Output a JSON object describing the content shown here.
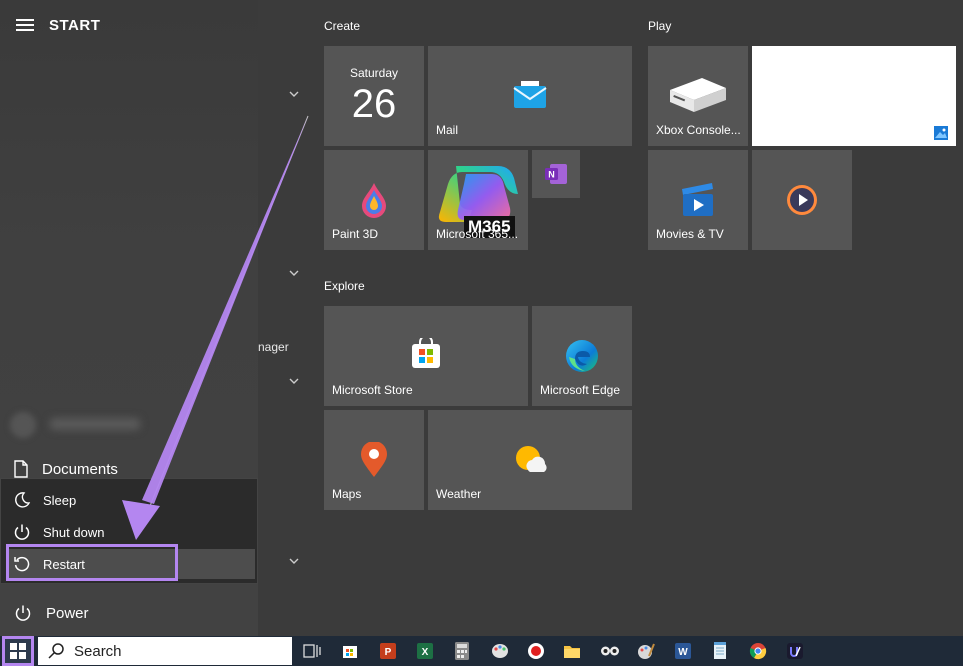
{
  "start_menu": {
    "title": "START",
    "partial_label": "nager",
    "documents_label": "Documents",
    "power_label": "Power",
    "power_menu": {
      "sleep": "Sleep",
      "shut_down": "Shut down",
      "restart": "Restart"
    }
  },
  "groups": {
    "create": {
      "title": "Create",
      "calendar": {
        "weekday": "Saturday",
        "day": "26"
      },
      "mail": "Mail",
      "paint3d": "Paint 3D",
      "m365": "Microsoft 365...",
      "m365_badge": "M365"
    },
    "play": {
      "title": "Play",
      "xbox": "Xbox Console...",
      "movies": "Movies & TV"
    },
    "explore": {
      "title": "Explore",
      "store": "Microsoft Store",
      "edge": "Microsoft Edge",
      "maps": "Maps",
      "weather": "Weather"
    }
  },
  "taskbar": {
    "search_label": "Search",
    "apps": [
      "task-view",
      "store",
      "powerpoint",
      "excel",
      "calculator",
      "paint",
      "record",
      "file-explorer",
      "tripadvisor",
      "paint-brush",
      "word",
      "notepad",
      "chrome",
      "app"
    ]
  },
  "colors": {
    "accent_purple": "#b486f0",
    "tile_gray": "#555555",
    "taskbar": "#1f2a38"
  }
}
